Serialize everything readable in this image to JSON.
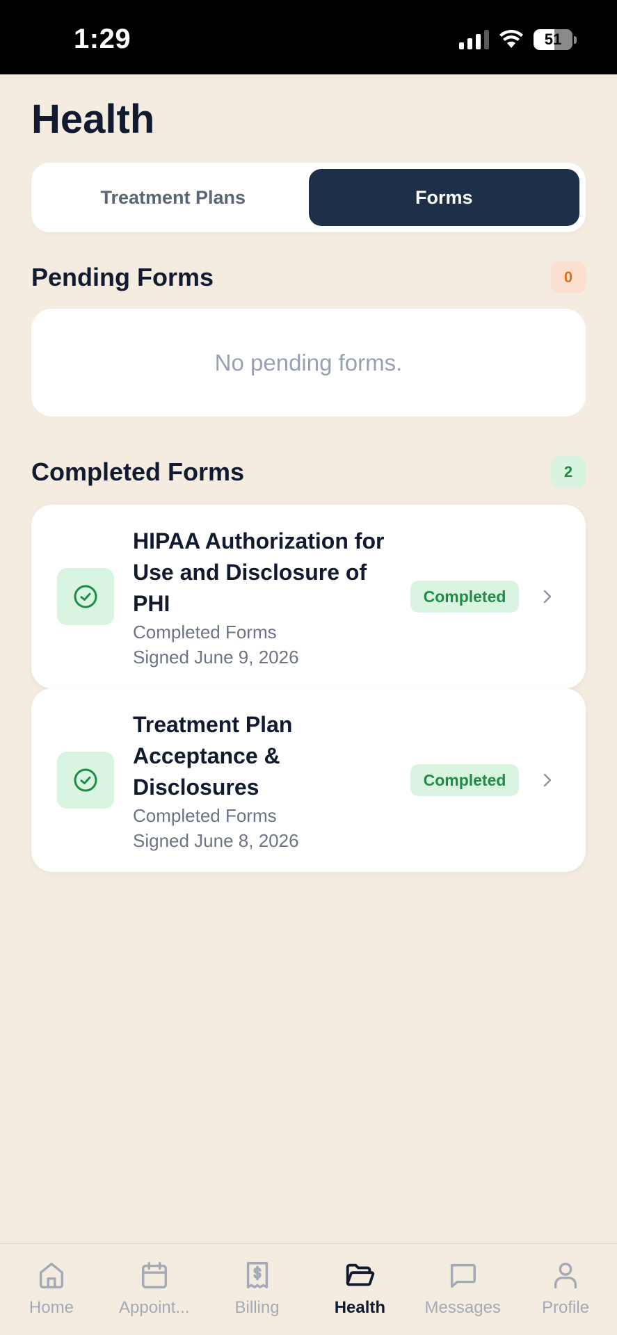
{
  "status_bar": {
    "time": "1:29",
    "battery": "51"
  },
  "page": {
    "title": "Health"
  },
  "segments": [
    {
      "label": "Treatment Plans",
      "active": false
    },
    {
      "label": "Forms",
      "active": true
    }
  ],
  "pending": {
    "title": "Pending Forms",
    "count": "0",
    "empty_text": "No pending forms."
  },
  "completed": {
    "title": "Completed Forms",
    "count": "2",
    "items": [
      {
        "title": "HIPAA Authorization for Use and Disclosure of PHI",
        "category": "Completed Forms",
        "signed": "Signed June 9, 2026",
        "status": "Completed",
        "icon": "check-circle-icon"
      },
      {
        "title": "Treatment Plan Acceptance & Disclosures",
        "category": "Completed Forms",
        "signed": "Signed June 8, 2026",
        "status": "Completed",
        "icon": "check-circle-icon"
      }
    ]
  },
  "tabs": [
    {
      "label": "Home",
      "icon": "home-icon"
    },
    {
      "label": "Appoint...",
      "icon": "calendar-icon"
    },
    {
      "label": "Billing",
      "icon": "receipt-icon"
    },
    {
      "label": "Health",
      "icon": "folder-open-icon",
      "active": true
    },
    {
      "label": "Messages",
      "icon": "message-icon"
    },
    {
      "label": "Profile",
      "icon": "user-icon"
    }
  ],
  "colors": {
    "background": "#f4ece1",
    "accent": "#1e2f4a",
    "success": "#1f8c45",
    "warning": "#d9701f"
  }
}
